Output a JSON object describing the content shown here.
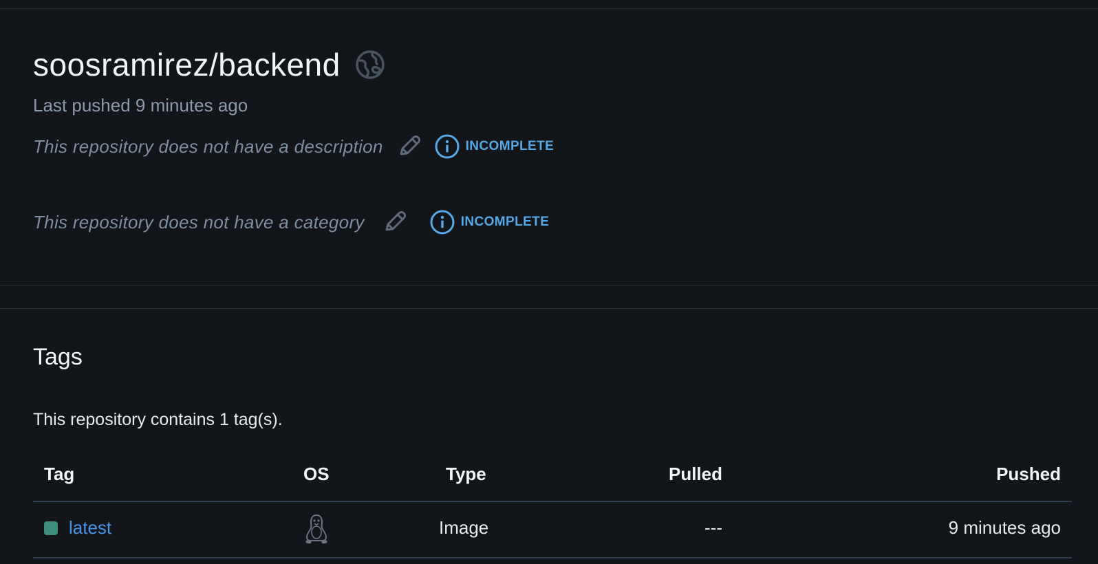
{
  "repo": {
    "title": "soosramirez/backend",
    "visibility_icon": "globe-icon",
    "last_pushed": "Last pushed 9 minutes ago",
    "description_text": "This repository does not have a description",
    "category_text": "This repository does not have a category",
    "incomplete_label": "INCOMPLETE"
  },
  "tags": {
    "title": "Tags",
    "count_text": "This repository contains 1 tag(s).",
    "columns": [
      "Tag",
      "OS",
      "Type",
      "Pulled",
      "Pushed"
    ],
    "rows": [
      {
        "tag": "latest",
        "os_icon": "linux-icon",
        "type": "Image",
        "pulled": "---",
        "pushed": "9 minutes ago"
      }
    ]
  },
  "colors": {
    "background": "#12151a",
    "accent_blue": "#57a8e6",
    "link_blue": "#4a94e8",
    "status_green": "#3d8f7c",
    "muted_text": "#8c9aab"
  }
}
